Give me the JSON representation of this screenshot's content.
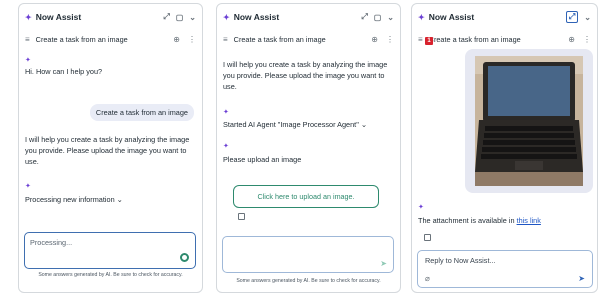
{
  "app": {
    "title": "Now Assist",
    "conversation_title": "Create a task from an image"
  },
  "panel1": {
    "greeting": "Hi. How can I help you?",
    "user_message": "Create a task from an image",
    "assistant_message": "I will help you create a task by analyzing the image you provide. Please upload the image you want to use.",
    "status": "Processing new information",
    "input_placeholder": "Processing...",
    "disclaimer": "Some answers generated by AI. Be sure to check for accuracy."
  },
  "panel2": {
    "assistant_message": "I will help you create a task by analyzing the image you provide. Please upload the image you want to use.",
    "agent_status": "Started AI Agent \"Image Processor Agent\"",
    "prompt": "Please upload an image",
    "upload_button": "Click here to upload an image.",
    "disclaimer": "Some answers generated by AI. Be sure to check for accuracy."
  },
  "panel3": {
    "badge": "1",
    "attachment_prefix": "The attachment is available in ",
    "attachment_link": "this link",
    "input_placeholder": "Reply to Now Assist..."
  },
  "colors": {
    "accent": "#6b3fd4",
    "link": "#1e56c4",
    "button_border": "#2e8a6e",
    "input_border": "#3f6fb0"
  },
  "icons": [
    "sparkle-icon",
    "expand-icon",
    "dock-icon",
    "chevron-down-icon",
    "menu-icon",
    "add-icon",
    "more-icon",
    "send-icon",
    "attach-icon",
    "copy-icon",
    "alert-icon"
  ]
}
